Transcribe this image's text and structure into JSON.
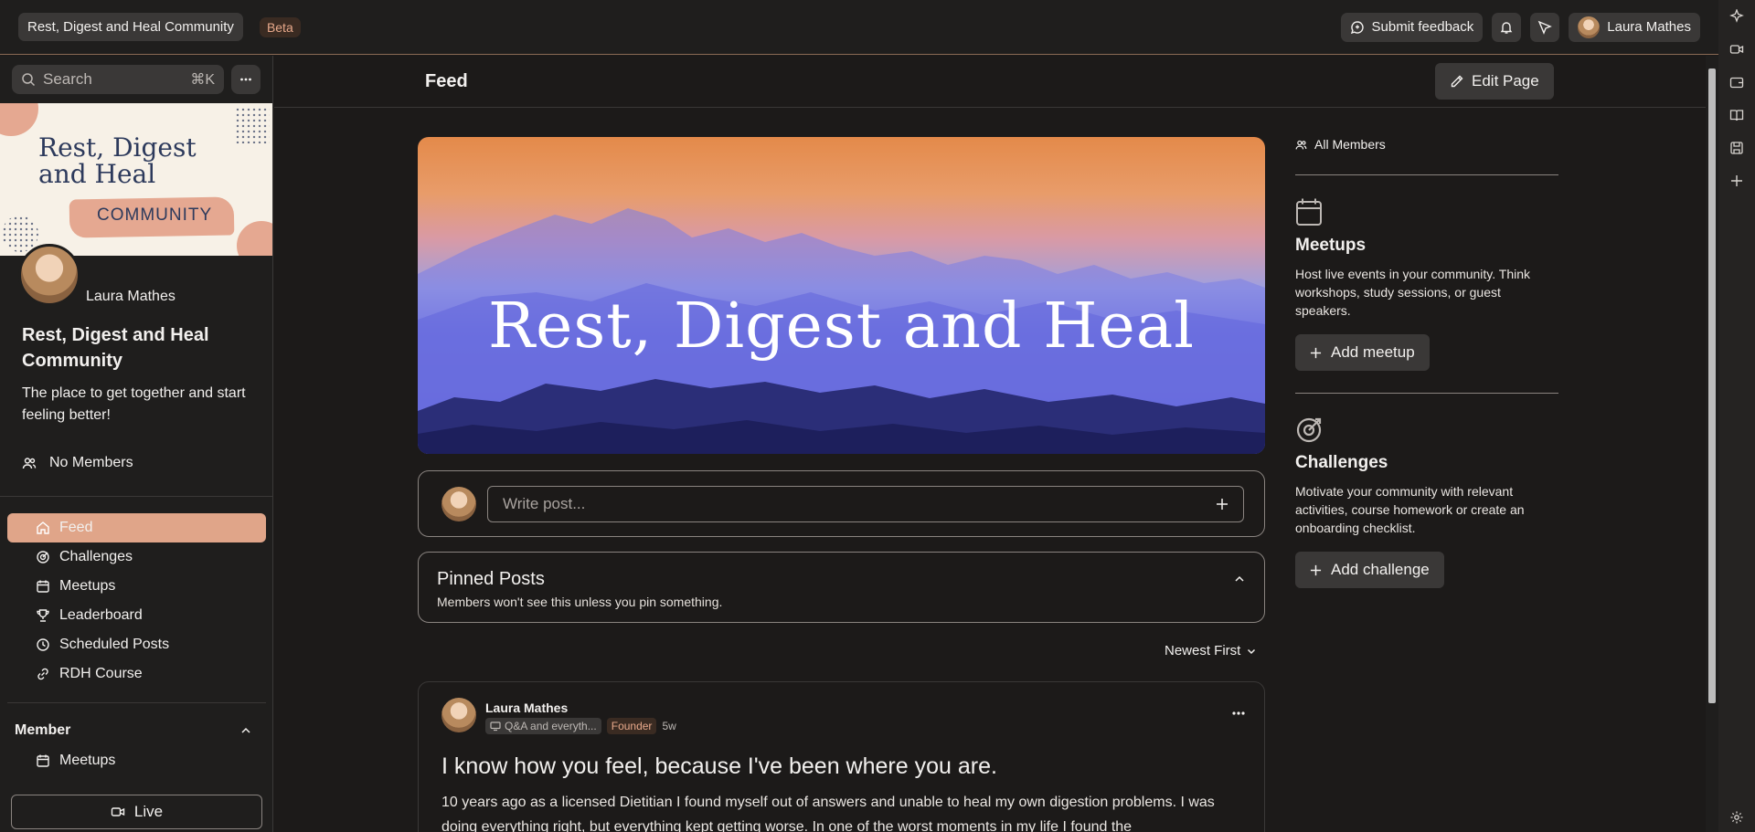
{
  "topbar": {
    "community_name": "Rest, Digest and Heal Community",
    "beta_label": "Beta",
    "feedback_label": "Submit feedback",
    "user_name": "Laura Mathes"
  },
  "sidebar": {
    "search_placeholder": "Search",
    "search_shortcut": "⌘K",
    "banner_title_line1": "Rest, Digest",
    "banner_title_line2": "and Heal",
    "banner_subtitle": "COMMUNITY",
    "owner_name": "Laura Mathes",
    "community_title": "Rest, Digest and Heal Community",
    "community_description": "The place to get together and start feeling better!",
    "members_label": "No Members",
    "nav": [
      {
        "label": "Feed",
        "icon": "home-icon",
        "active": true
      },
      {
        "label": "Challenges",
        "icon": "target-icon",
        "active": false
      },
      {
        "label": "Meetups",
        "icon": "calendar-icon",
        "active": false
      },
      {
        "label": "Leaderboard",
        "icon": "trophy-icon",
        "active": false
      },
      {
        "label": "Scheduled Posts",
        "icon": "clock-icon",
        "active": false
      },
      {
        "label": "RDH Course",
        "icon": "link-icon",
        "active": false
      }
    ],
    "section_title": "Member",
    "section_item": "Meetups",
    "live_label": "Live"
  },
  "main": {
    "title": "Feed",
    "edit_label": "Edit Page",
    "hero_text": "Rest, Digest and Heal",
    "write_placeholder": "Write post...",
    "pinned_title": "Pinned Posts",
    "pinned_subtitle": "Members won't see this unless you pin something.",
    "sort_label": "Newest First"
  },
  "post": {
    "author": "Laura Mathes",
    "category": "Q&A and everyth...",
    "badge": "Founder",
    "time": "5w",
    "title": "I know how you feel, because I've been where you are.",
    "body": "10 years ago as a licensed Dietitian I found myself out of answers and unable to heal my own digestion problems. I was doing everything right, but everything kept getting worse. In one of the worst moments in my life I found the"
  },
  "rightcol": {
    "all_members": "All Members",
    "meetups_title": "Meetups",
    "meetups_desc": "Host live events in your community. Think workshops, study sessions, or guest speakers.",
    "meetups_btn": "Add meetup",
    "challenges_title": "Challenges",
    "challenges_desc": "Motivate your community with relevant activities, course homework or create an onboarding checklist.",
    "challenges_btn": "Add challenge"
  },
  "colors": {
    "accent": "#e0a589",
    "background": "#1c1a19",
    "surface": "#3a3837"
  }
}
